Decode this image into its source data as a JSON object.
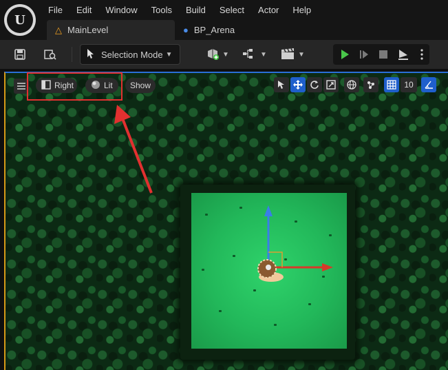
{
  "menu": [
    "File",
    "Edit",
    "Window",
    "Tools",
    "Build",
    "Select",
    "Actor",
    "Help"
  ],
  "tabs": [
    {
      "label": "MainLevel",
      "icon": "level-icon",
      "active": true
    },
    {
      "label": "BP_Arena",
      "icon": "blueprint-icon",
      "active": false
    }
  ],
  "toolbar": {
    "mode_label": "Selection Mode"
  },
  "viewport": {
    "view_label": "Right",
    "lit_label": "Lit",
    "show_label": "Show",
    "grid_value": "10"
  },
  "colors": {
    "accent_blue": "#1f5fcc",
    "play_green": "#49c64a",
    "highlight_red": "#e23030",
    "grass": "#2fd36b"
  }
}
